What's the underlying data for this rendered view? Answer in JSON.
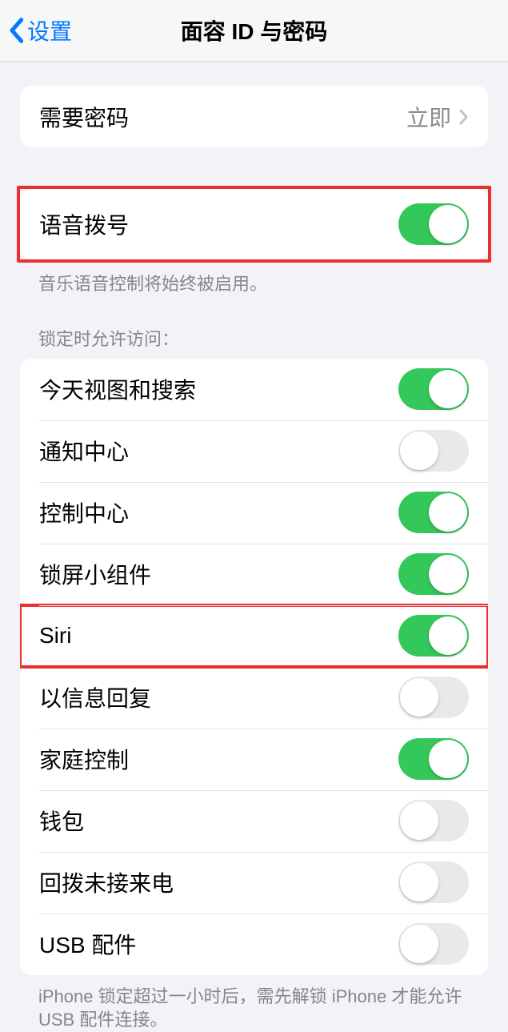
{
  "nav": {
    "back": "设置",
    "title": "面容 ID 与密码"
  },
  "passcode_group": {
    "require_label": "需要密码",
    "require_value": "立即"
  },
  "voice_dial": {
    "label": "语音拨号",
    "footer": "音乐语音控制将始终被启用。"
  },
  "locked_access": {
    "header": "锁定时允许访问：",
    "items": [
      {
        "label": "今天视图和搜索",
        "on": true
      },
      {
        "label": "通知中心",
        "on": false
      },
      {
        "label": "控制中心",
        "on": true
      },
      {
        "label": "锁屏小组件",
        "on": true
      },
      {
        "label": "Siri",
        "on": true
      },
      {
        "label": "以信息回复",
        "on": false
      },
      {
        "label": "家庭控制",
        "on": true
      },
      {
        "label": "钱包",
        "on": false
      },
      {
        "label": "回拨未接来电",
        "on": false
      },
      {
        "label": "USB 配件",
        "on": false
      }
    ],
    "footer": "iPhone 锁定超过一小时后，需先解锁 iPhone 才能允许 USB 配件连接。"
  }
}
